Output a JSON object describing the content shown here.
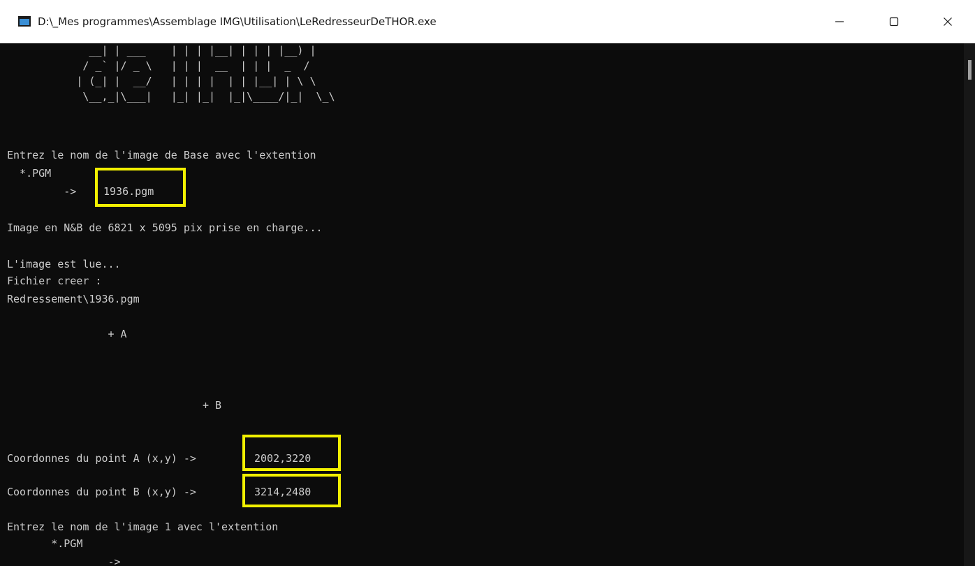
{
  "window": {
    "title": "D:\\_Mes programmes\\Assemblage IMG\\Utilisation\\LeRedresseurDeTHOR.exe",
    "minimize_glyph": "—",
    "maximize_glyph": "☐",
    "close_glyph": "✕"
  },
  "console": {
    "banner": [
      "             __| | ___    | | | |__| | | | |__) |",
      "            / _` |/ _ \\   | | |  __  | | |  _  /",
      "           | (_| |  __/   | | | |  | | |__| | \\ \\",
      "            \\__,_|\\___|   |_| |_|  |_|\\____/|_|  \\_\\"
    ],
    "prompt_base": "Entrez le nom de l'image de Base avec l'extention",
    "ext_base": "  *.PGM",
    "arrow_base": "         -> ",
    "input_base": "1936.pgm",
    "image_info": "Image en N&B de 6821 x 5095 pix prise en charge...",
    "lue": "L'image est lue...",
    "fichier": "Fichier creer :",
    "fichier_path": "Redressement\\1936.pgm",
    "point_a": "                + A",
    "point_b": "                               + B",
    "coord_a_label": "Coordonnes du point A (x,y) -> ",
    "coord_a_value": "2002,3220",
    "coord_b_label": "Coordonnes du point B (x,y) -> ",
    "coord_b_value": "3214,2480",
    "prompt_1": "Entrez le nom de l'image 1 avec l'extention",
    "ext_1": "       *.PGM",
    "arrow_1": "                ->"
  },
  "colors": {
    "background": "#0c0c0c",
    "text": "#cccccc",
    "highlight": "#f2f000"
  }
}
